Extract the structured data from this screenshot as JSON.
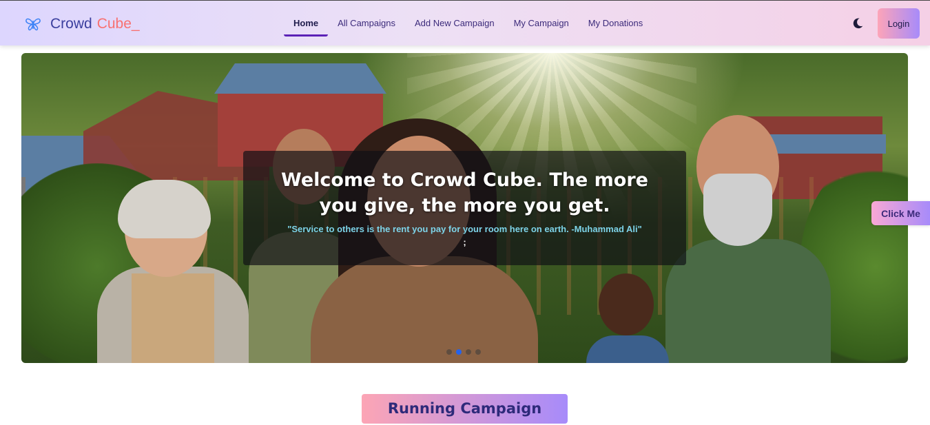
{
  "brand": {
    "word1": "Crowd",
    "word2": "Cube",
    "cursor": "_",
    "logo_icon": "butterfly-icon"
  },
  "nav": {
    "items": [
      {
        "label": "Home",
        "active": true
      },
      {
        "label": "All Campaigns",
        "active": false
      },
      {
        "label": "Add New Campaign",
        "active": false
      },
      {
        "label": "My Campaign",
        "active": false
      },
      {
        "label": "My Donations",
        "active": false
      }
    ],
    "theme_toggle_icon": "moon-icon",
    "login_label": "Login"
  },
  "hero": {
    "headline": "Welcome to Crowd Cube. The more you give, the more you get.",
    "quote": "\"Service to others is the rent you pay for your room here on earth. -Muhammad Ali\"",
    "trailing": ";",
    "slides": 4,
    "active_slide": 2
  },
  "side_tab": {
    "label": "Click Me"
  },
  "section": {
    "title": "Running Campaign"
  },
  "colors": {
    "navbar_start": "#ddd6fe",
    "navbar_end": "#f5d0e6",
    "brand_primary": "#3b3f9e",
    "brand_accent": "#f87171",
    "button_gradient_start": "#fda4b8",
    "button_gradient_end": "#a78bfa",
    "quote_color": "#7dd3e8",
    "active_dot": "#2563eb"
  }
}
